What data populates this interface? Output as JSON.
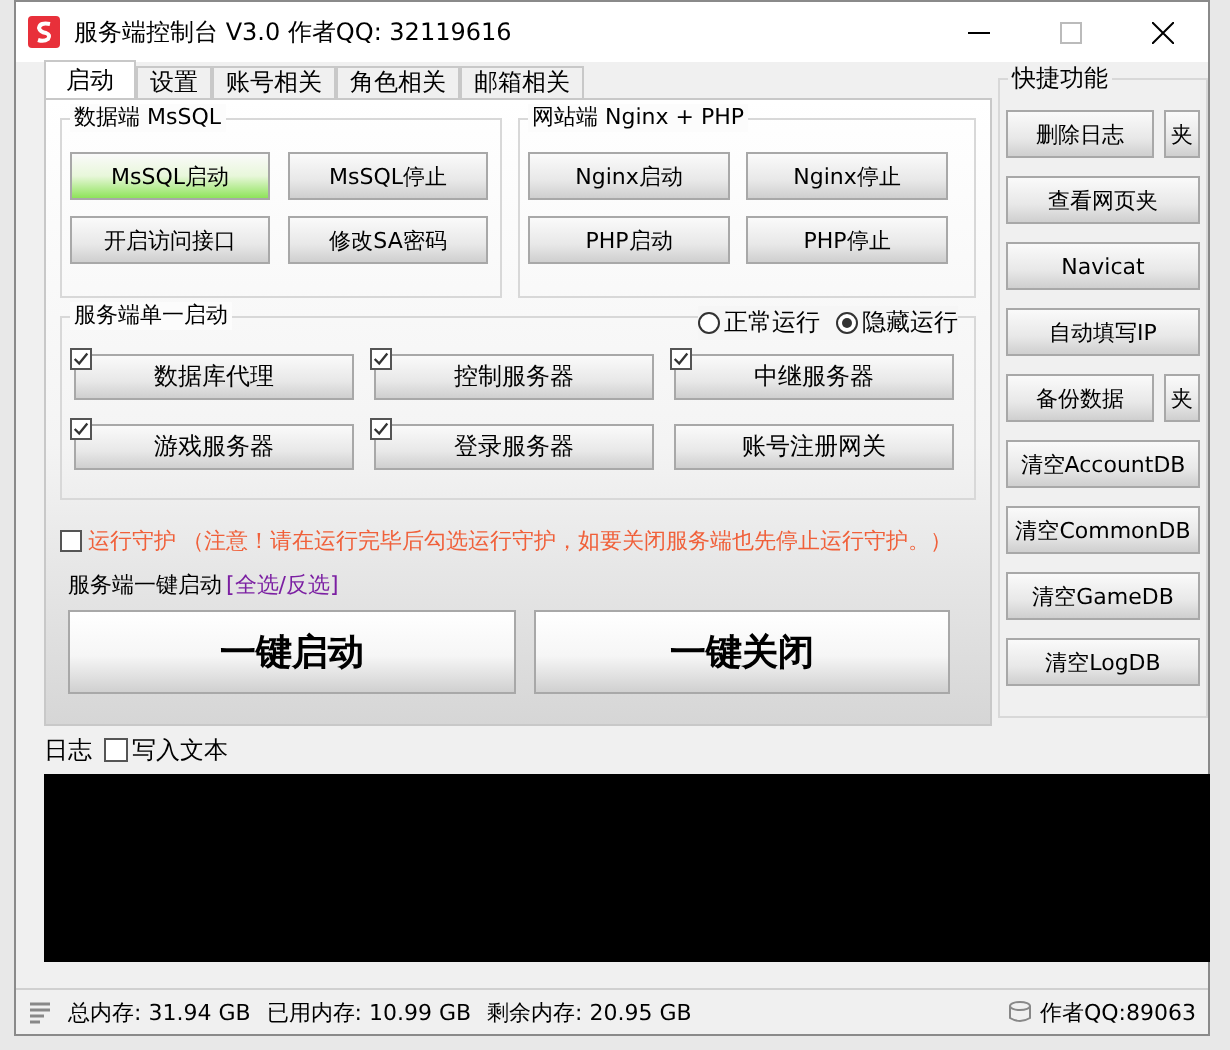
{
  "window": {
    "title": "服务端控制台 V3.0 作者QQ: 32119616"
  },
  "tabs": [
    {
      "label": "启动",
      "selected": true
    },
    {
      "label": "设置",
      "selected": false
    },
    {
      "label": "账号相关",
      "selected": false
    },
    {
      "label": "角色相关",
      "selected": false
    },
    {
      "label": "邮箱相关",
      "selected": false
    }
  ],
  "mssql_group": {
    "title": "数据端 MsSQL",
    "buttons": [
      {
        "label": "MsSQL启动",
        "active": true
      },
      {
        "label": "MsSQL停止",
        "active": false
      },
      {
        "label": "开启访问接口",
        "active": false
      },
      {
        "label": "修改SA密码",
        "active": false
      }
    ]
  },
  "web_group": {
    "title": "网站端 Nginx + PHP",
    "buttons": [
      {
        "label": "Nginx启动",
        "active": false
      },
      {
        "label": "Nginx停止",
        "active": false
      },
      {
        "label": "PHP启动",
        "active": false
      },
      {
        "label": "PHP停止",
        "active": false
      }
    ]
  },
  "server_group": {
    "title": "服务端单一启动",
    "run_modes": [
      {
        "label": "正常运行",
        "selected": false
      },
      {
        "label": "隐藏运行",
        "selected": true
      }
    ],
    "servers": [
      {
        "label": "数据库代理",
        "kind": "checkbox",
        "checked": true
      },
      {
        "label": "控制服务器",
        "kind": "checkbox",
        "checked": true
      },
      {
        "label": "中继服务器",
        "kind": "checkbox",
        "checked": true
      },
      {
        "label": "游戏服务器",
        "kind": "checkbox",
        "checked": true
      },
      {
        "label": "登录服务器",
        "kind": "checkbox",
        "checked": true
      },
      {
        "label": "账号注册网关",
        "kind": "plain"
      }
    ]
  },
  "guard": {
    "label": "运行守护",
    "note": "（注意！请在运行完毕后勾选运行守护，如要关闭服务端也先停止运行守护。）",
    "checked": false
  },
  "one_key": {
    "label": "服务端一键启动",
    "link": "[全选/反选]",
    "buttons": [
      "一键启动",
      "一键关闭"
    ]
  },
  "quick": {
    "title": "快捷功能",
    "rows": [
      [
        "删除日志",
        "夹"
      ],
      [
        "查看网页夹"
      ],
      [
        "Navicat"
      ],
      [
        "自动填写IP"
      ],
      [
        "备份数据",
        "夹"
      ],
      [
        "清空AccountDB"
      ],
      [
        "清空CommonDB"
      ],
      [
        "清空GameDB"
      ],
      [
        "清空LogDB"
      ]
    ]
  },
  "log": {
    "label": "日志",
    "write_text": {
      "label": "写入文本",
      "checked": false
    }
  },
  "status_bar": {
    "items": [
      "总内存: 31.94 GB",
      "已用内存: 10.99 GB",
      "剩余内存: 20.95 GB"
    ],
    "author": "作者QQ:89063"
  }
}
